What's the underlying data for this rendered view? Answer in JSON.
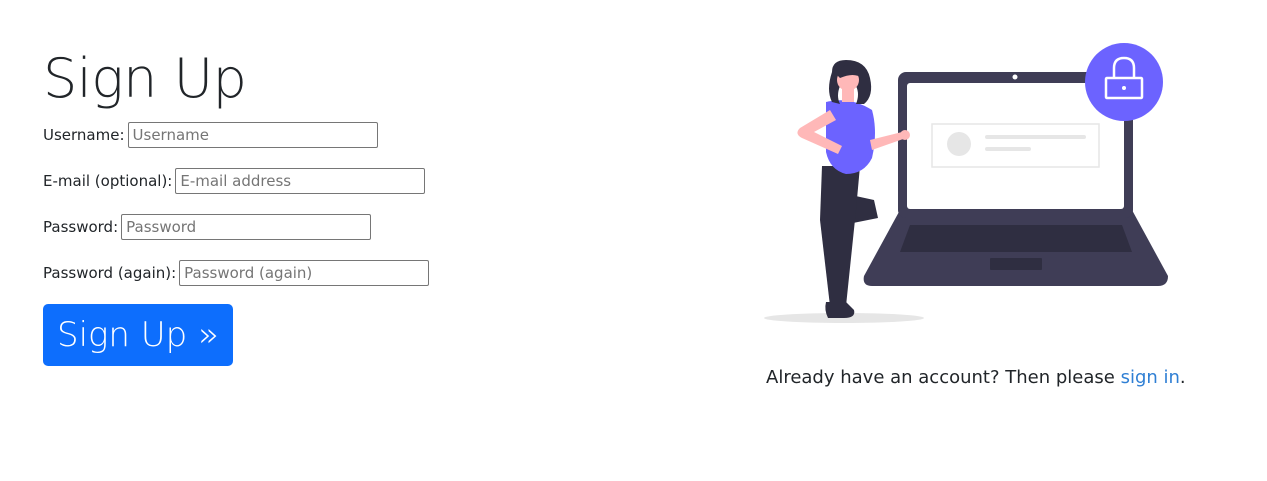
{
  "form": {
    "title": "Sign Up",
    "fields": [
      {
        "label": "Username:",
        "placeholder": "Username",
        "value": ""
      },
      {
        "label": "E-mail (optional):",
        "placeholder": "E-mail address",
        "value": ""
      },
      {
        "label": "Password:",
        "placeholder": "Password",
        "value": ""
      },
      {
        "label": "Password (again):",
        "placeholder": "Password (again)",
        "value": ""
      }
    ],
    "submit_label": "Sign Up »"
  },
  "signin": {
    "prefix": "Already have an account? Then please ",
    "link_text": "sign in",
    "suffix": "."
  },
  "colors": {
    "primary": "#0d6efd",
    "accent_purple": "#6c63ff",
    "laptop_dark": "#3f3d56",
    "link": "#2f7fd4"
  },
  "icons": {
    "illustration": "person-with-laptop-illustration",
    "lock": "lock-icon"
  }
}
